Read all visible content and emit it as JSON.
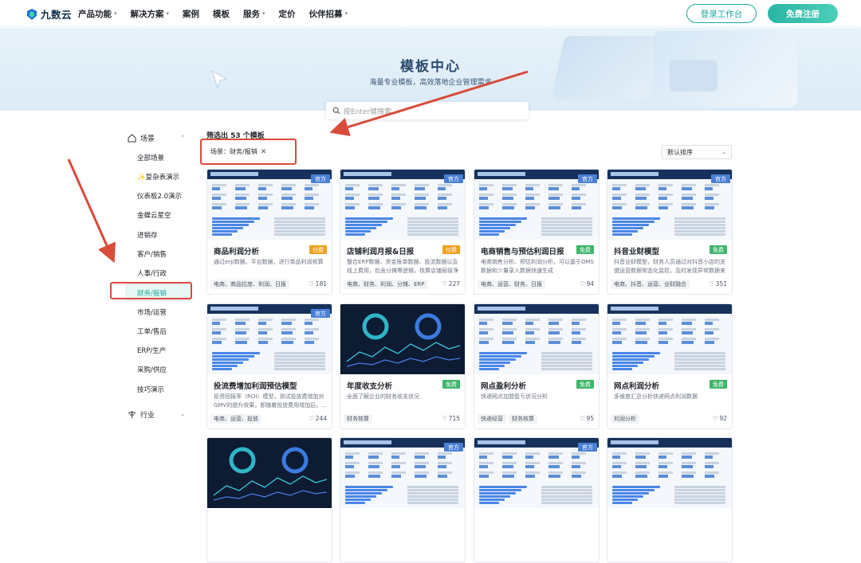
{
  "nav": {
    "logo_text": "九数云",
    "links": [
      {
        "label": "产品功能",
        "dropdown": true
      },
      {
        "label": "解决方案",
        "dropdown": true
      },
      {
        "label": "案例",
        "dropdown": false
      },
      {
        "label": "模板",
        "dropdown": false
      },
      {
        "label": "服务",
        "dropdown": true
      },
      {
        "label": "定价",
        "dropdown": false
      },
      {
        "label": "伙伴招募",
        "dropdown": true
      }
    ],
    "login_label": "登录工作台",
    "register_label": "免费注册"
  },
  "banner": {
    "title": "模板中心",
    "subtitle": "海量专业模板，高效落地企业管理需求"
  },
  "search": {
    "placeholder": "按Enter键搜索"
  },
  "sidebar": {
    "scene_label": "场景",
    "industry_label": "行业",
    "items": [
      "全部场景",
      "✨复杂表演示",
      "仪表板2.0演示",
      "金蝶云星空",
      "进销存",
      "客户/销售",
      "人事/行政",
      "财务/报销",
      "市场/运营",
      "工单/售后",
      "ERP/生产",
      "采购/供应",
      "技巧演示"
    ],
    "active_index": 7
  },
  "filter": {
    "count_text": "筛选出 53 个模板",
    "tag_text": "场景：财务/报销",
    "sort_label": "默认排序"
  },
  "colors": {
    "accent": "#1aa99a",
    "official": "#4a7fd6",
    "paid": "#f0a020",
    "free": "#3fb56a",
    "annotation": "#d94b3a"
  },
  "cards": [
    {
      "title": "商品利润分析",
      "badge": "官方",
      "price": "付费",
      "desc": "通过erp数据、平台数据，进行单品利润核算",
      "tags": [
        "电商、商品拉度、利润、日报"
      ],
      "likes": "181",
      "theme": "light"
    },
    {
      "title": "店铺利润月报&日报",
      "badge": "官方",
      "price": "付费",
      "desc": "整合ERP数据、资金账单数据、投流数据以及线上费用，包含分摊等逻辑，核算店铺层级净利...",
      "tags": [
        "电商、财务、利润、分摊、ERP"
      ],
      "likes": "227",
      "theme": "light"
    },
    {
      "title": "电商销售与预估利润日报",
      "badge": "官方",
      "price": "免费",
      "desc": "电商销售分析、预估利润分析，可以基于OMS数据和少量录入数据快速生成",
      "tags": [
        "电商、运营、财务、日报"
      ],
      "likes": "94",
      "theme": "light"
    },
    {
      "title": "抖音业财模型",
      "badge": "官方",
      "price": "免费",
      "desc": "抖音业财模型，财务人员通过对抖音小店的关键运营数据常态化监控，及时发现异常数据来有...",
      "tags": [
        "电商、抖音、运营、业财融合"
      ],
      "likes": "351",
      "theme": "light"
    },
    {
      "title": "投流费增加利润预估模型",
      "badge": "官方",
      "price": "",
      "desc": "投资回报率（ROI）模型，测试投放费增加对GMV的提升效果，即随着投放费用增加后，...",
      "tags": [
        "电商、运营、投放"
      ],
      "likes": "244",
      "theme": "light"
    },
    {
      "title": "年度收支分析",
      "badge": "",
      "price": "免费",
      "desc": "全面了解企业的财务收支状况",
      "tags": [
        "财务核算"
      ],
      "likes": "715",
      "theme": "dark"
    },
    {
      "title": "网点盈利分析",
      "badge": "",
      "price": "免费",
      "desc": "快递网点加盟盈亏状况分析",
      "tags": [
        "快递经营",
        "财务核算"
      ],
      "likes": "95",
      "theme": "light"
    },
    {
      "title": "网点利润分析",
      "badge": "",
      "price": "免费",
      "desc": "多维度汇总分析快递网点利润数据",
      "tags": [
        "利润分析"
      ],
      "likes": "92",
      "theme": "light"
    },
    {
      "title": "",
      "badge": "",
      "price": "",
      "desc": "",
      "tags": [],
      "likes": "",
      "theme": "dark"
    },
    {
      "title": "",
      "badge": "官方",
      "price": "",
      "desc": "",
      "tags": [],
      "likes": "",
      "theme": "light"
    },
    {
      "title": "",
      "badge": "官方",
      "price": "",
      "desc": "",
      "tags": [],
      "likes": "",
      "theme": "light"
    },
    {
      "title": "",
      "badge": "",
      "price": "",
      "desc": "",
      "tags": [],
      "likes": "",
      "theme": "light"
    }
  ]
}
